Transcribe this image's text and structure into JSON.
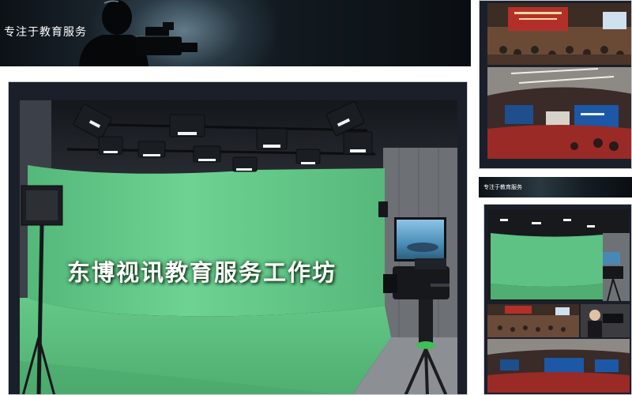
{
  "banner": {
    "tagline": "专注于教育服务"
  },
  "main_photo": {
    "caption": "东博视讯教育服务工作坊"
  },
  "right_panel": {
    "small_banner_tagline": "专注于教育服务"
  },
  "colors": {
    "chroma_green": "#5fc483",
    "frame_dark": "#1b1f2a",
    "banner_dark": "#0c1116"
  },
  "icons": [
    "camera-silhouette-icon",
    "studio-light-icon",
    "video-camera-icon",
    "tripod-icon"
  ]
}
